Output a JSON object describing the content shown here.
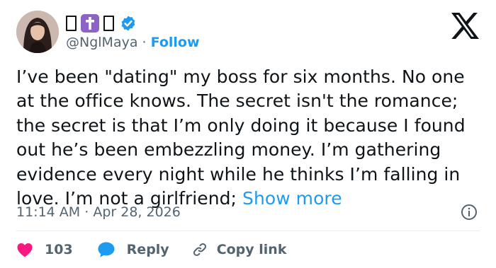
{
  "author": {
    "name_glyphs": [
      "□",
      "✝",
      "□"
    ],
    "handle": "@NglMaya",
    "separator": "·",
    "follow_label": "Follow"
  },
  "tweet": {
    "lines": [
      "I’ve been \"dating\" my boss for six months. No one",
      "at the office knows. The secret isn't the romance;",
      "the secret is that I’m only doing it because I found",
      "out he’s been embezzling money. I’m gathering",
      "evidence every night while he thinks I’m falling in",
      "love. I’m not a girlfriend;"
    ],
    "show_more_label": "Show more"
  },
  "meta": {
    "time": "11:14 AM",
    "separator": "·",
    "date": "Apr 28, 2026"
  },
  "actions": {
    "like_count": "103",
    "reply_label": "Reply",
    "copy_link_label": "Copy link"
  },
  "colors": {
    "accent": "#1d9bf0",
    "like": "#f91880",
    "text": "#0f1419",
    "secondary": "#536471",
    "cross_badge": "#8e63c6"
  },
  "icons": {
    "brand": "x-logo-icon",
    "verified": "verified-badge-icon",
    "info": "info-icon",
    "like": "heart-icon",
    "reply": "speech-bubble-icon",
    "copy_link": "link-icon"
  }
}
